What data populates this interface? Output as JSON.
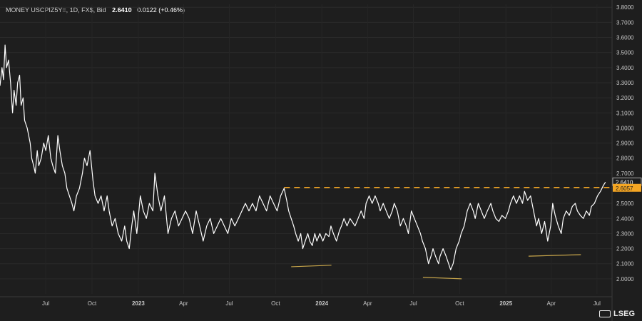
{
  "header": {
    "symbol": "MONEY USCPIZ5Y=, 1D, FX$, Bid",
    "last": "2.6410",
    "change": "0.0122 (+0.46%)"
  },
  "brand": "LSEG",
  "colors": {
    "background": "#1e1e1e",
    "line": "#ffffff",
    "resistance": "#f5a623",
    "support": "#c8a64b",
    "axis_text": "#c8c8c8"
  },
  "chart_data": {
    "type": "line",
    "x_tick_labels": [
      "Jul",
      "Oct",
      "2023",
      "Apr",
      "Jul",
      "Oct",
      "2024",
      "Apr",
      "Jul",
      "Oct",
      "2025",
      "Apr",
      "Jul"
    ],
    "x_tick_dates": [
      "2022-07-01",
      "2022-10-01",
      "2023-01-01",
      "2023-04-01",
      "2023-07-01",
      "2023-10-01",
      "2024-01-01",
      "2024-04-01",
      "2024-07-01",
      "2024-10-01",
      "2025-01-01",
      "2025-04-01",
      "2025-07-01"
    ],
    "y_tick_labels": [
      "2.0000",
      "2.1000",
      "2.2000",
      "2.3000",
      "2.4000",
      "2.5000",
      "2.6000",
      "2.7000",
      "2.8000",
      "2.9000",
      "3.0000",
      "3.1000",
      "3.2000",
      "3.3000",
      "3.4000",
      "3.5000",
      "3.6000",
      "3.7000",
      "3.8000"
    ],
    "ylim": [
      1.9,
      3.82
    ],
    "xlim": [
      "2022-04-01",
      "2025-07-31"
    ],
    "series": [
      {
        "points": [
          [
            "2022-04-01",
            3.28
          ],
          [
            "2022-04-05",
            3.4
          ],
          [
            "2022-04-08",
            3.32
          ],
          [
            "2022-04-11",
            3.55
          ],
          [
            "2022-04-14",
            3.4
          ],
          [
            "2022-04-18",
            3.45
          ],
          [
            "2022-04-22",
            3.3
          ],
          [
            "2022-04-26",
            3.1
          ],
          [
            "2022-04-29",
            3.25
          ],
          [
            "2022-05-03",
            3.15
          ],
          [
            "2022-05-06",
            3.3
          ],
          [
            "2022-05-10",
            3.35
          ],
          [
            "2022-05-13",
            3.15
          ],
          [
            "2022-05-17",
            3.2
          ],
          [
            "2022-05-20",
            3.05
          ],
          [
            "2022-05-25",
            3.0
          ],
          [
            "2022-05-31",
            2.9
          ],
          [
            "2022-06-03",
            2.8
          ],
          [
            "2022-06-07",
            2.75
          ],
          [
            "2022-06-10",
            2.7
          ],
          [
            "2022-06-14",
            2.85
          ],
          [
            "2022-06-17",
            2.75
          ],
          [
            "2022-06-22",
            2.8
          ],
          [
            "2022-06-27",
            2.9
          ],
          [
            "2022-07-01",
            2.85
          ],
          [
            "2022-07-06",
            2.95
          ],
          [
            "2022-07-11",
            2.8
          ],
          [
            "2022-07-15",
            2.75
          ],
          [
            "2022-07-20",
            2.7
          ],
          [
            "2022-07-25",
            2.95
          ],
          [
            "2022-07-29",
            2.85
          ],
          [
            "2022-08-03",
            2.75
          ],
          [
            "2022-08-08",
            2.7
          ],
          [
            "2022-08-12",
            2.6
          ],
          [
            "2022-08-17",
            2.55
          ],
          [
            "2022-08-22",
            2.5
          ],
          [
            "2022-08-26",
            2.45
          ],
          [
            "2022-08-31",
            2.55
          ],
          [
            "2022-09-06",
            2.6
          ],
          [
            "2022-09-12",
            2.7
          ],
          [
            "2022-09-16",
            2.8
          ],
          [
            "2022-09-21",
            2.75
          ],
          [
            "2022-09-27",
            2.85
          ],
          [
            "2022-10-03",
            2.65
          ],
          [
            "2022-10-07",
            2.55
          ],
          [
            "2022-10-13",
            2.5
          ],
          [
            "2022-10-19",
            2.55
          ],
          [
            "2022-10-25",
            2.45
          ],
          [
            "2022-10-31",
            2.55
          ],
          [
            "2022-11-04",
            2.45
          ],
          [
            "2022-11-10",
            2.35
          ],
          [
            "2022-11-16",
            2.4
          ],
          [
            "2022-11-22",
            2.3
          ],
          [
            "2022-11-29",
            2.25
          ],
          [
            "2022-12-05",
            2.35
          ],
          [
            "2022-12-09",
            2.25
          ],
          [
            "2022-12-14",
            2.2
          ],
          [
            "2022-12-19",
            2.35
          ],
          [
            "2022-12-23",
            2.45
          ],
          [
            "2022-12-29",
            2.3
          ],
          [
            "2023-01-05",
            2.55
          ],
          [
            "2023-01-11",
            2.45
          ],
          [
            "2023-01-17",
            2.4
          ],
          [
            "2023-01-23",
            2.5
          ],
          [
            "2023-01-30",
            2.45
          ],
          [
            "2023-02-03",
            2.7
          ],
          [
            "2023-02-09",
            2.55
          ],
          [
            "2023-02-15",
            2.45
          ],
          [
            "2023-02-22",
            2.55
          ],
          [
            "2023-03-01",
            2.3
          ],
          [
            "2023-03-08",
            2.4
          ],
          [
            "2023-03-15",
            2.45
          ],
          [
            "2023-03-22",
            2.35
          ],
          [
            "2023-03-29",
            2.4
          ],
          [
            "2023-04-05",
            2.45
          ],
          [
            "2023-04-12",
            2.4
          ],
          [
            "2023-04-19",
            2.3
          ],
          [
            "2023-04-26",
            2.45
          ],
          [
            "2023-05-03",
            2.35
          ],
          [
            "2023-05-10",
            2.25
          ],
          [
            "2023-05-17",
            2.35
          ],
          [
            "2023-05-24",
            2.4
          ],
          [
            "2023-05-31",
            2.3
          ],
          [
            "2023-06-07",
            2.35
          ],
          [
            "2023-06-14",
            2.4
          ],
          [
            "2023-06-21",
            2.35
          ],
          [
            "2023-06-28",
            2.3
          ],
          [
            "2023-07-05",
            2.4
          ],
          [
            "2023-07-12",
            2.35
          ],
          [
            "2023-07-19",
            2.4
          ],
          [
            "2023-07-26",
            2.45
          ],
          [
            "2023-08-02",
            2.5
          ],
          [
            "2023-08-09",
            2.45
          ],
          [
            "2023-08-16",
            2.5
          ],
          [
            "2023-08-23",
            2.45
          ],
          [
            "2023-08-30",
            2.55
          ],
          [
            "2023-09-06",
            2.5
          ],
          [
            "2023-09-13",
            2.45
          ],
          [
            "2023-09-20",
            2.55
          ],
          [
            "2023-09-27",
            2.5
          ],
          [
            "2023-10-04",
            2.45
          ],
          [
            "2023-10-11",
            2.55
          ],
          [
            "2023-10-18",
            2.6
          ],
          [
            "2023-10-23",
            2.52
          ],
          [
            "2023-10-27",
            2.45
          ],
          [
            "2023-11-01",
            2.4
          ],
          [
            "2023-11-06",
            2.35
          ],
          [
            "2023-11-10",
            2.3
          ],
          [
            "2023-11-15",
            2.25
          ],
          [
            "2023-11-20",
            2.3
          ],
          [
            "2023-11-24",
            2.2
          ],
          [
            "2023-11-29",
            2.25
          ],
          [
            "2023-12-04",
            2.3
          ],
          [
            "2023-12-08",
            2.25
          ],
          [
            "2023-12-13",
            2.22
          ],
          [
            "2023-12-18",
            2.3
          ],
          [
            "2023-12-22",
            2.25
          ],
          [
            "2023-12-28",
            2.3
          ],
          [
            "2024-01-03",
            2.25
          ],
          [
            "2024-01-09",
            2.3
          ],
          [
            "2024-01-15",
            2.28
          ],
          [
            "2024-01-19",
            2.35
          ],
          [
            "2024-01-24",
            2.3
          ],
          [
            "2024-01-30",
            2.25
          ],
          [
            "2024-02-05",
            2.32
          ],
          [
            "2024-02-09",
            2.35
          ],
          [
            "2024-02-14",
            2.4
          ],
          [
            "2024-02-20",
            2.35
          ],
          [
            "2024-02-26",
            2.4
          ],
          [
            "2024-03-01",
            2.38
          ],
          [
            "2024-03-07",
            2.35
          ],
          [
            "2024-03-13",
            2.4
          ],
          [
            "2024-03-19",
            2.45
          ],
          [
            "2024-03-25",
            2.4
          ],
          [
            "2024-03-29",
            2.5
          ],
          [
            "2024-04-04",
            2.55
          ],
          [
            "2024-04-10",
            2.5
          ],
          [
            "2024-04-16",
            2.55
          ],
          [
            "2024-04-22",
            2.5
          ],
          [
            "2024-04-26",
            2.45
          ],
          [
            "2024-05-02",
            2.5
          ],
          [
            "2024-05-08",
            2.45
          ],
          [
            "2024-05-14",
            2.4
          ],
          [
            "2024-05-20",
            2.45
          ],
          [
            "2024-05-24",
            2.5
          ],
          [
            "2024-05-30",
            2.45
          ],
          [
            "2024-06-05",
            2.35
          ],
          [
            "2024-06-11",
            2.4
          ],
          [
            "2024-06-17",
            2.35
          ],
          [
            "2024-06-21",
            2.3
          ],
          [
            "2024-06-27",
            2.45
          ],
          [
            "2024-07-03",
            2.4
          ],
          [
            "2024-07-09",
            2.35
          ],
          [
            "2024-07-15",
            2.3
          ],
          [
            "2024-07-19",
            2.25
          ],
          [
            "2024-07-25",
            2.2
          ],
          [
            "2024-07-31",
            2.1
          ],
          [
            "2024-08-05",
            2.15
          ],
          [
            "2024-08-09",
            2.2
          ],
          [
            "2024-08-14",
            2.15
          ],
          [
            "2024-08-20",
            2.1
          ],
          [
            "2024-08-23",
            2.15
          ],
          [
            "2024-08-29",
            2.2
          ],
          [
            "2024-09-04",
            2.15
          ],
          [
            "2024-09-09",
            2.1
          ],
          [
            "2024-09-13",
            2.06
          ],
          [
            "2024-09-18",
            2.1
          ],
          [
            "2024-09-24",
            2.2
          ],
          [
            "2024-09-30",
            2.25
          ],
          [
            "2024-10-04",
            2.3
          ],
          [
            "2024-10-10",
            2.35
          ],
          [
            "2024-10-16",
            2.45
          ],
          [
            "2024-10-22",
            2.5
          ],
          [
            "2024-10-28",
            2.45
          ],
          [
            "2024-11-01",
            2.4
          ],
          [
            "2024-11-07",
            2.5
          ],
          [
            "2024-11-13",
            2.45
          ],
          [
            "2024-11-19",
            2.4
          ],
          [
            "2024-11-25",
            2.45
          ],
          [
            "2024-12-02",
            2.5
          ],
          [
            "2024-12-06",
            2.45
          ],
          [
            "2024-12-12",
            2.4
          ],
          [
            "2024-12-18",
            2.38
          ],
          [
            "2024-12-24",
            2.42
          ],
          [
            "2024-12-31",
            2.4
          ],
          [
            "2025-01-06",
            2.45
          ],
          [
            "2025-01-10",
            2.5
          ],
          [
            "2025-01-16",
            2.55
          ],
          [
            "2025-01-22",
            2.5
          ],
          [
            "2025-01-28",
            2.55
          ],
          [
            "2025-02-03",
            2.5
          ],
          [
            "2025-02-07",
            2.58
          ],
          [
            "2025-02-13",
            2.52
          ],
          [
            "2025-02-19",
            2.55
          ],
          [
            "2025-02-25",
            2.45
          ],
          [
            "2025-03-03",
            2.35
          ],
          [
            "2025-03-07",
            2.4
          ],
          [
            "2025-03-13",
            2.3
          ],
          [
            "2025-03-19",
            2.38
          ],
          [
            "2025-03-25",
            2.25
          ],
          [
            "2025-03-31",
            2.35
          ],
          [
            "2025-04-04",
            2.5
          ],
          [
            "2025-04-09",
            2.42
          ],
          [
            "2025-04-15",
            2.35
          ],
          [
            "2025-04-21",
            2.3
          ],
          [
            "2025-04-25",
            2.4
          ],
          [
            "2025-05-01",
            2.45
          ],
          [
            "2025-05-07",
            2.42
          ],
          [
            "2025-05-13",
            2.48
          ],
          [
            "2025-05-19",
            2.5
          ],
          [
            "2025-05-23",
            2.45
          ],
          [
            "2025-05-29",
            2.42
          ],
          [
            "2025-06-04",
            2.4
          ],
          [
            "2025-06-10",
            2.45
          ],
          [
            "2025-06-16",
            2.42
          ],
          [
            "2025-06-20",
            2.48
          ],
          [
            "2025-06-26",
            2.5
          ],
          [
            "2025-07-02",
            2.55
          ],
          [
            "2025-07-08",
            2.58
          ],
          [
            "2025-07-14",
            2.62
          ],
          [
            "2025-07-18",
            2.641
          ]
        ]
      }
    ],
    "resistance_line": {
      "value": 2.6057,
      "label": "2.6057",
      "from": "2023-10-18"
    },
    "last_value_label": "2.6410",
    "support_lines": [
      {
        "from": "2023-11-01",
        "to": "2024-01-20",
        "y_from": 2.08,
        "y_to": 2.09
      },
      {
        "from": "2024-07-20",
        "to": "2024-10-05",
        "y_from": 2.01,
        "y_to": 2.0
      },
      {
        "from": "2025-02-15",
        "to": "2025-05-30",
        "y_from": 2.15,
        "y_to": 2.16
      }
    ]
  }
}
